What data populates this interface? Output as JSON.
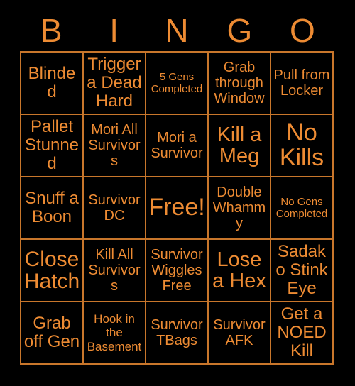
{
  "card": {
    "title": "Bingo Card",
    "background_color": "#000000",
    "text_color": "#ED8B33",
    "grid_line_color": "#C8762B",
    "columns": 5,
    "rows": 5,
    "free_space": "Free!",
    "free_space_index": 12
  },
  "header": {
    "letters": [
      {
        "label": "B"
      },
      {
        "label": "I"
      },
      {
        "label": "N"
      },
      {
        "label": "G"
      },
      {
        "label": "O"
      }
    ]
  },
  "grid": {
    "cells": [
      {
        "text": "Blinded",
        "size": "lg"
      },
      {
        "text": "Trigger a Dead Hard",
        "size": "lg"
      },
      {
        "text": "5 Gens Completed",
        "size": "xs"
      },
      {
        "text": "Grab through Window",
        "size": "md"
      },
      {
        "text": "Pull from Locker",
        "size": "md"
      },
      {
        "text": "Pallet Stunned",
        "size": "lg"
      },
      {
        "text": "Mori All Survivors",
        "size": "md"
      },
      {
        "text": "Mori a Survivor",
        "size": "md"
      },
      {
        "text": "Kill a Meg",
        "size": "xl"
      },
      {
        "text": "No Kills",
        "size": "xxl"
      },
      {
        "text": "Snuff a Boon",
        "size": "lg"
      },
      {
        "text": "Survivor DC",
        "size": "md"
      },
      {
        "text": "Free!",
        "size": "xxl"
      },
      {
        "text": "Double Whammy",
        "size": "md"
      },
      {
        "text": "No Gens Completed",
        "size": "xs"
      },
      {
        "text": "Close Hatch",
        "size": "xxl"
      },
      {
        "text": "Kill All Survivors",
        "size": "md"
      },
      {
        "text": "Survivor Wiggles Free",
        "size": "md"
      },
      {
        "text": "Lose a Hex",
        "size": "xl"
      },
      {
        "text": "Sadako Stink Eye",
        "size": "lg"
      },
      {
        "text": "Grab off Gen",
        "size": "lg"
      },
      {
        "text": "Hook in the Basement",
        "size": "sm"
      },
      {
        "text": "Survivor TBags",
        "size": "md"
      },
      {
        "text": "Survivor AFK",
        "size": "md"
      },
      {
        "text": "Get a NOED Kill",
        "size": "lg"
      }
    ]
  }
}
